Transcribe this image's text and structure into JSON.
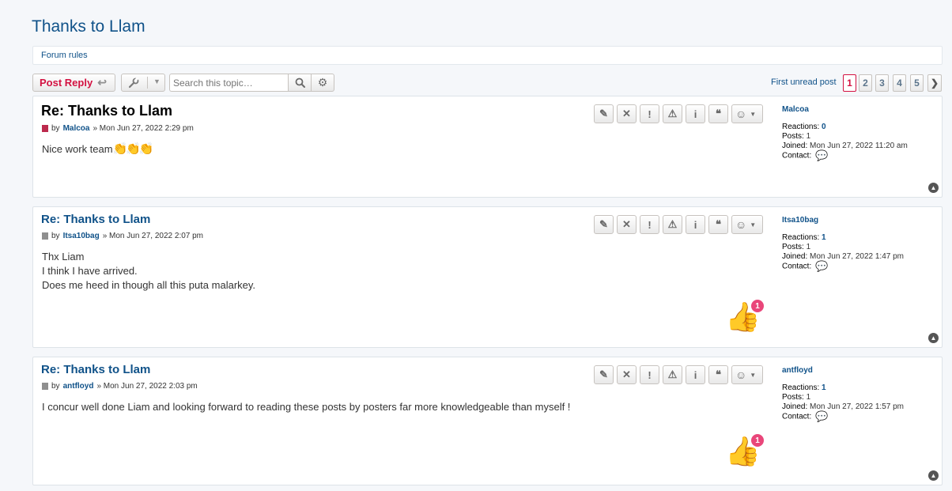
{
  "topic": {
    "title": "Thanks to Llam",
    "forum_rules": "Forum rules"
  },
  "toolbar": {
    "post_reply_label": "Post Reply",
    "search_placeholder": "Search this topic…",
    "first_unread_label": "First unread post"
  },
  "pagination": {
    "pages": [
      "1",
      "2",
      "3",
      "4",
      "5"
    ],
    "active": "1"
  },
  "posts": [
    {
      "title": "Re: Thanks to Llam",
      "by": "by",
      "author": "Malcoa",
      "date": "» Mon Jun 27, 2022 2:29 pm",
      "body": [
        "Nice work team"
      ],
      "emoji": "👏👏👏",
      "profile": {
        "username": "Malcoa",
        "reactions_label": "Reactions:",
        "reactions": "0",
        "posts_label": "Posts:",
        "posts": "1",
        "joined_label": "Joined:",
        "joined": "Mon Jun 27, 2022 11:20 am",
        "contact_label": "Contact:"
      }
    },
    {
      "title": "Re: Thanks to Llam",
      "by": "by",
      "author": "Itsa10bag",
      "date": "» Mon Jun 27, 2022 2:07 pm",
      "body": [
        "Thx Liam",
        "I think I have arrived.",
        "Does me heed in though all this puta malarkey."
      ],
      "reaction_count": "1",
      "profile": {
        "username": "Itsa10bag",
        "reactions_label": "Reactions:",
        "reactions": "1",
        "posts_label": "Posts:",
        "posts": "1",
        "joined_label": "Joined:",
        "joined": "Mon Jun 27, 2022 1:47 pm",
        "contact_label": "Contact:"
      }
    },
    {
      "title": "Re: Thanks to Llam",
      "by": "by",
      "author": "antfloyd",
      "date": "» Mon Jun 27, 2022 2:03 pm",
      "body": [
        "I concur well done Liam and looking forward to reading these posts by posters far more knowledgeable than myself !"
      ],
      "reaction_count": "1",
      "profile": {
        "username": "antfloyd",
        "reactions_label": "Reactions:",
        "reactions": "1",
        "posts_label": "Posts:",
        "posts": "1",
        "joined_label": "Joined:",
        "joined": "Mon Jun 27, 2022 1:57 pm",
        "contact_label": "Contact:"
      }
    }
  ],
  "colors": {
    "link": "#105289",
    "accent_red": "#d31141",
    "badge_pink": "#e9467a"
  }
}
